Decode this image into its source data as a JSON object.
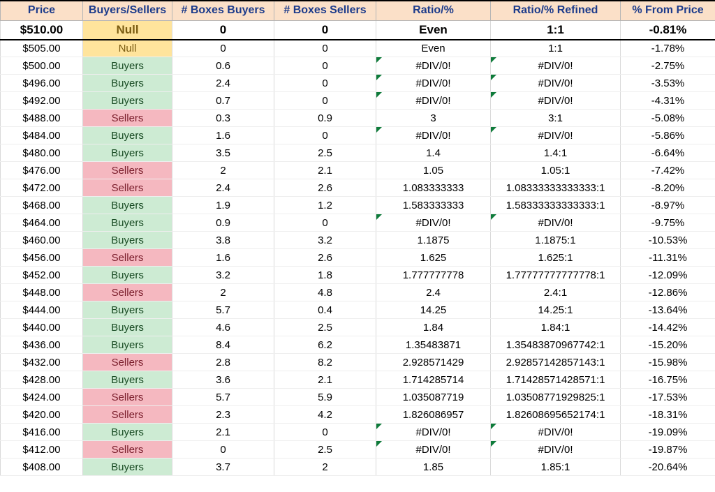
{
  "columns": [
    "Price",
    "Buyers/Sellers",
    "# Boxes Buyers",
    "# Boxes Sellers",
    "Ratio/%",
    "Ratio/% Refined",
    "% From Price"
  ],
  "rows": [
    {
      "price": "$510.00",
      "bs": "Null",
      "bs_class": "null",
      "bb": "0",
      "bsell": "0",
      "ratio": "Even",
      "ratio_err": false,
      "refined": "1:1",
      "refined_err": false,
      "pct": "-0.81%",
      "bold": true
    },
    {
      "price": "$505.00",
      "bs": "Null",
      "bs_class": "null",
      "bb": "0",
      "bsell": "0",
      "ratio": "Even",
      "ratio_err": false,
      "refined": "1:1",
      "refined_err": false,
      "pct": "-1.78%",
      "bold": false
    },
    {
      "price": "$500.00",
      "bs": "Buyers",
      "bs_class": "buyers",
      "bb": "0.6",
      "bsell": "0",
      "ratio": "#DIV/0!",
      "ratio_err": true,
      "refined": "#DIV/0!",
      "refined_err": true,
      "pct": "-2.75%",
      "bold": false
    },
    {
      "price": "$496.00",
      "bs": "Buyers",
      "bs_class": "buyers",
      "bb": "2.4",
      "bsell": "0",
      "ratio": "#DIV/0!",
      "ratio_err": true,
      "refined": "#DIV/0!",
      "refined_err": true,
      "pct": "-3.53%",
      "bold": false
    },
    {
      "price": "$492.00",
      "bs": "Buyers",
      "bs_class": "buyers",
      "bb": "0.7",
      "bsell": "0",
      "ratio": "#DIV/0!",
      "ratio_err": true,
      "refined": "#DIV/0!",
      "refined_err": true,
      "pct": "-4.31%",
      "bold": false
    },
    {
      "price": "$488.00",
      "bs": "Sellers",
      "bs_class": "sellers",
      "bb": "0.3",
      "bsell": "0.9",
      "ratio": "3",
      "ratio_err": false,
      "refined": "3:1",
      "refined_err": false,
      "pct": "-5.08%",
      "bold": false
    },
    {
      "price": "$484.00",
      "bs": "Buyers",
      "bs_class": "buyers",
      "bb": "1.6",
      "bsell": "0",
      "ratio": "#DIV/0!",
      "ratio_err": true,
      "refined": "#DIV/0!",
      "refined_err": true,
      "pct": "-5.86%",
      "bold": false
    },
    {
      "price": "$480.00",
      "bs": "Buyers",
      "bs_class": "buyers",
      "bb": "3.5",
      "bsell": "2.5",
      "ratio": "1.4",
      "ratio_err": false,
      "refined": "1.4:1",
      "refined_err": false,
      "pct": "-6.64%",
      "bold": false
    },
    {
      "price": "$476.00",
      "bs": "Sellers",
      "bs_class": "sellers",
      "bb": "2",
      "bsell": "2.1",
      "ratio": "1.05",
      "ratio_err": false,
      "refined": "1.05:1",
      "refined_err": false,
      "pct": "-7.42%",
      "bold": false
    },
    {
      "price": "$472.00",
      "bs": "Sellers",
      "bs_class": "sellers",
      "bb": "2.4",
      "bsell": "2.6",
      "ratio": "1.083333333",
      "ratio_err": false,
      "refined": "1.08333333333333:1",
      "refined_err": false,
      "pct": "-8.20%",
      "bold": false
    },
    {
      "price": "$468.00",
      "bs": "Buyers",
      "bs_class": "buyers",
      "bb": "1.9",
      "bsell": "1.2",
      "ratio": "1.583333333",
      "ratio_err": false,
      "refined": "1.58333333333333:1",
      "refined_err": false,
      "pct": "-8.97%",
      "bold": false
    },
    {
      "price": "$464.00",
      "bs": "Buyers",
      "bs_class": "buyers",
      "bb": "0.9",
      "bsell": "0",
      "ratio": "#DIV/0!",
      "ratio_err": true,
      "refined": "#DIV/0!",
      "refined_err": true,
      "pct": "-9.75%",
      "bold": false
    },
    {
      "price": "$460.00",
      "bs": "Buyers",
      "bs_class": "buyers",
      "bb": "3.8",
      "bsell": "3.2",
      "ratio": "1.1875",
      "ratio_err": false,
      "refined": "1.1875:1",
      "refined_err": false,
      "pct": "-10.53%",
      "bold": false
    },
    {
      "price": "$456.00",
      "bs": "Sellers",
      "bs_class": "sellers",
      "bb": "1.6",
      "bsell": "2.6",
      "ratio": "1.625",
      "ratio_err": false,
      "refined": "1.625:1",
      "refined_err": false,
      "pct": "-11.31%",
      "bold": false
    },
    {
      "price": "$452.00",
      "bs": "Buyers",
      "bs_class": "buyers",
      "bb": "3.2",
      "bsell": "1.8",
      "ratio": "1.777777778",
      "ratio_err": false,
      "refined": "1.77777777777778:1",
      "refined_err": false,
      "pct": "-12.09%",
      "bold": false
    },
    {
      "price": "$448.00",
      "bs": "Sellers",
      "bs_class": "sellers",
      "bb": "2",
      "bsell": "4.8",
      "ratio": "2.4",
      "ratio_err": false,
      "refined": "2.4:1",
      "refined_err": false,
      "pct": "-12.86%",
      "bold": false
    },
    {
      "price": "$444.00",
      "bs": "Buyers",
      "bs_class": "buyers",
      "bb": "5.7",
      "bsell": "0.4",
      "ratio": "14.25",
      "ratio_err": false,
      "refined": "14.25:1",
      "refined_err": false,
      "pct": "-13.64%",
      "bold": false
    },
    {
      "price": "$440.00",
      "bs": "Buyers",
      "bs_class": "buyers",
      "bb": "4.6",
      "bsell": "2.5",
      "ratio": "1.84",
      "ratio_err": false,
      "refined": "1.84:1",
      "refined_err": false,
      "pct": "-14.42%",
      "bold": false
    },
    {
      "price": "$436.00",
      "bs": "Buyers",
      "bs_class": "buyers",
      "bb": "8.4",
      "bsell": "6.2",
      "ratio": "1.35483871",
      "ratio_err": false,
      "refined": "1.35483870967742:1",
      "refined_err": false,
      "pct": "-15.20%",
      "bold": false
    },
    {
      "price": "$432.00",
      "bs": "Sellers",
      "bs_class": "sellers",
      "bb": "2.8",
      "bsell": "8.2",
      "ratio": "2.928571429",
      "ratio_err": false,
      "refined": "2.92857142857143:1",
      "refined_err": false,
      "pct": "-15.98%",
      "bold": false
    },
    {
      "price": "$428.00",
      "bs": "Buyers",
      "bs_class": "buyers",
      "bb": "3.6",
      "bsell": "2.1",
      "ratio": "1.714285714",
      "ratio_err": false,
      "refined": "1.71428571428571:1",
      "refined_err": false,
      "pct": "-16.75%",
      "bold": false
    },
    {
      "price": "$424.00",
      "bs": "Sellers",
      "bs_class": "sellers",
      "bb": "5.7",
      "bsell": "5.9",
      "ratio": "1.035087719",
      "ratio_err": false,
      "refined": "1.03508771929825:1",
      "refined_err": false,
      "pct": "-17.53%",
      "bold": false
    },
    {
      "price": "$420.00",
      "bs": "Sellers",
      "bs_class": "sellers",
      "bb": "2.3",
      "bsell": "4.2",
      "ratio": "1.826086957",
      "ratio_err": false,
      "refined": "1.82608695652174:1",
      "refined_err": false,
      "pct": "-18.31%",
      "bold": false
    },
    {
      "price": "$416.00",
      "bs": "Buyers",
      "bs_class": "buyers",
      "bb": "2.1",
      "bsell": "0",
      "ratio": "#DIV/0!",
      "ratio_err": true,
      "refined": "#DIV/0!",
      "refined_err": true,
      "pct": "-19.09%",
      "bold": false
    },
    {
      "price": "$412.00",
      "bs": "Sellers",
      "bs_class": "sellers",
      "bb": "0",
      "bsell": "2.5",
      "ratio": "#DIV/0!",
      "ratio_err": true,
      "refined": "#DIV/0!",
      "refined_err": true,
      "pct": "-19.87%",
      "bold": false
    },
    {
      "price": "$408.00",
      "bs": "Buyers",
      "bs_class": "buyers",
      "bb": "3.7",
      "bsell": "2",
      "ratio": "1.85",
      "ratio_err": false,
      "refined": "1.85:1",
      "refined_err": false,
      "pct": "-20.64%",
      "bold": false
    }
  ]
}
